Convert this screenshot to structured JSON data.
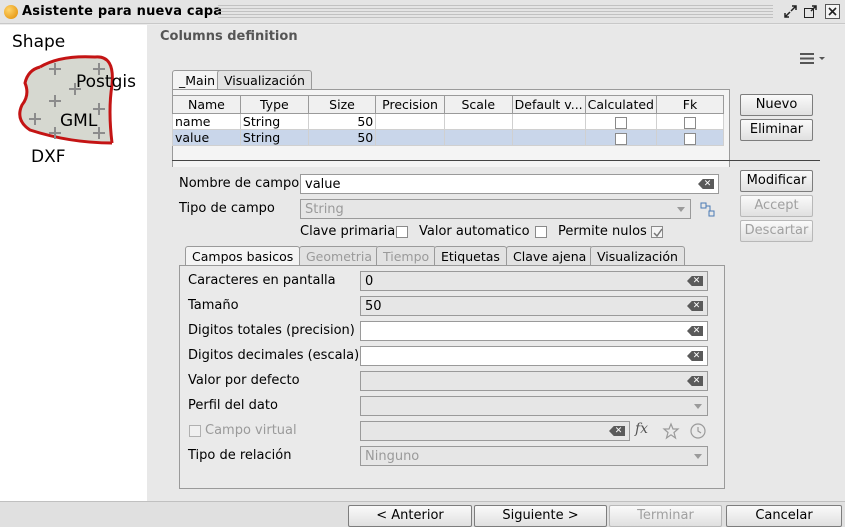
{
  "window": {
    "title": "Asistente para nueva capa",
    "controls": [
      "minimize-restore",
      "maximize",
      "close"
    ]
  },
  "left": {
    "formats": [
      "Shape",
      "Postgis",
      "GML",
      "DXF"
    ]
  },
  "header": {
    "title": "Columns definition"
  },
  "main_tabs": [
    {
      "label": "_Main",
      "active": true
    },
    {
      "label": "Visualización",
      "active": false
    }
  ],
  "table": {
    "columns": [
      "Name",
      "Type",
      "Size",
      "Precision",
      "Scale",
      "Default v...",
      "Calculated",
      "Fk"
    ],
    "rows": [
      {
        "name": "name",
        "type": "String",
        "size": "50",
        "precision": "",
        "scale": "",
        "default": "",
        "calculated": false,
        "fk": false,
        "selected": false
      },
      {
        "name": "value",
        "type": "String",
        "size": "50",
        "precision": "",
        "scale": "",
        "default": "",
        "calculated": false,
        "fk": false,
        "selected": true
      }
    ]
  },
  "side_buttons": {
    "nuevo": "Nuevo",
    "eliminar": "Eliminar",
    "modificar": "Modificar",
    "accept": "Accept",
    "descartar": "Descartar"
  },
  "form": {
    "nombre_label": "Nombre de campo",
    "nombre_value": "value",
    "tipo_label": "Tipo de campo",
    "tipo_value": "String",
    "clave_primaria": "Clave primaria",
    "valor_automatico": "Valor automatico",
    "permite_nulos": "Permite nulos",
    "permite_nulos_checked": true
  },
  "sub_tabs": [
    {
      "label": "Campos basicos",
      "active": true,
      "enabled": true
    },
    {
      "label": "Geometria",
      "active": false,
      "enabled": false
    },
    {
      "label": "Tiempo",
      "active": false,
      "enabled": false
    },
    {
      "label": "Etiquetas",
      "active": false,
      "enabled": true
    },
    {
      "label": "Clave ajena",
      "active": false,
      "enabled": true
    },
    {
      "label": "Visualización",
      "active": false,
      "enabled": true
    }
  ],
  "basic": {
    "caracteres_label": "Caracteres en pantalla",
    "caracteres_value": "0",
    "tamano_label": "Tamaño",
    "tamano_value": "50",
    "digitos_totales_label": "Digitos totales (precision)",
    "digitos_totales_value": "",
    "digitos_decimales_label": "Digitos decimales (escala)",
    "digitos_decimales_value": "",
    "valor_defecto_label": "Valor por defecto",
    "valor_defecto_value": "",
    "perfil_label": "Perfil del dato",
    "perfil_value": "",
    "campo_virtual_label": "Campo virtual",
    "tipo_relacion_label": "Tipo de relación",
    "tipo_relacion_value": "Ninguno"
  },
  "footer": {
    "anterior": "< Anterior",
    "siguiente": "Siguiente >",
    "terminar": "Terminar",
    "cancelar": "Cancelar"
  }
}
